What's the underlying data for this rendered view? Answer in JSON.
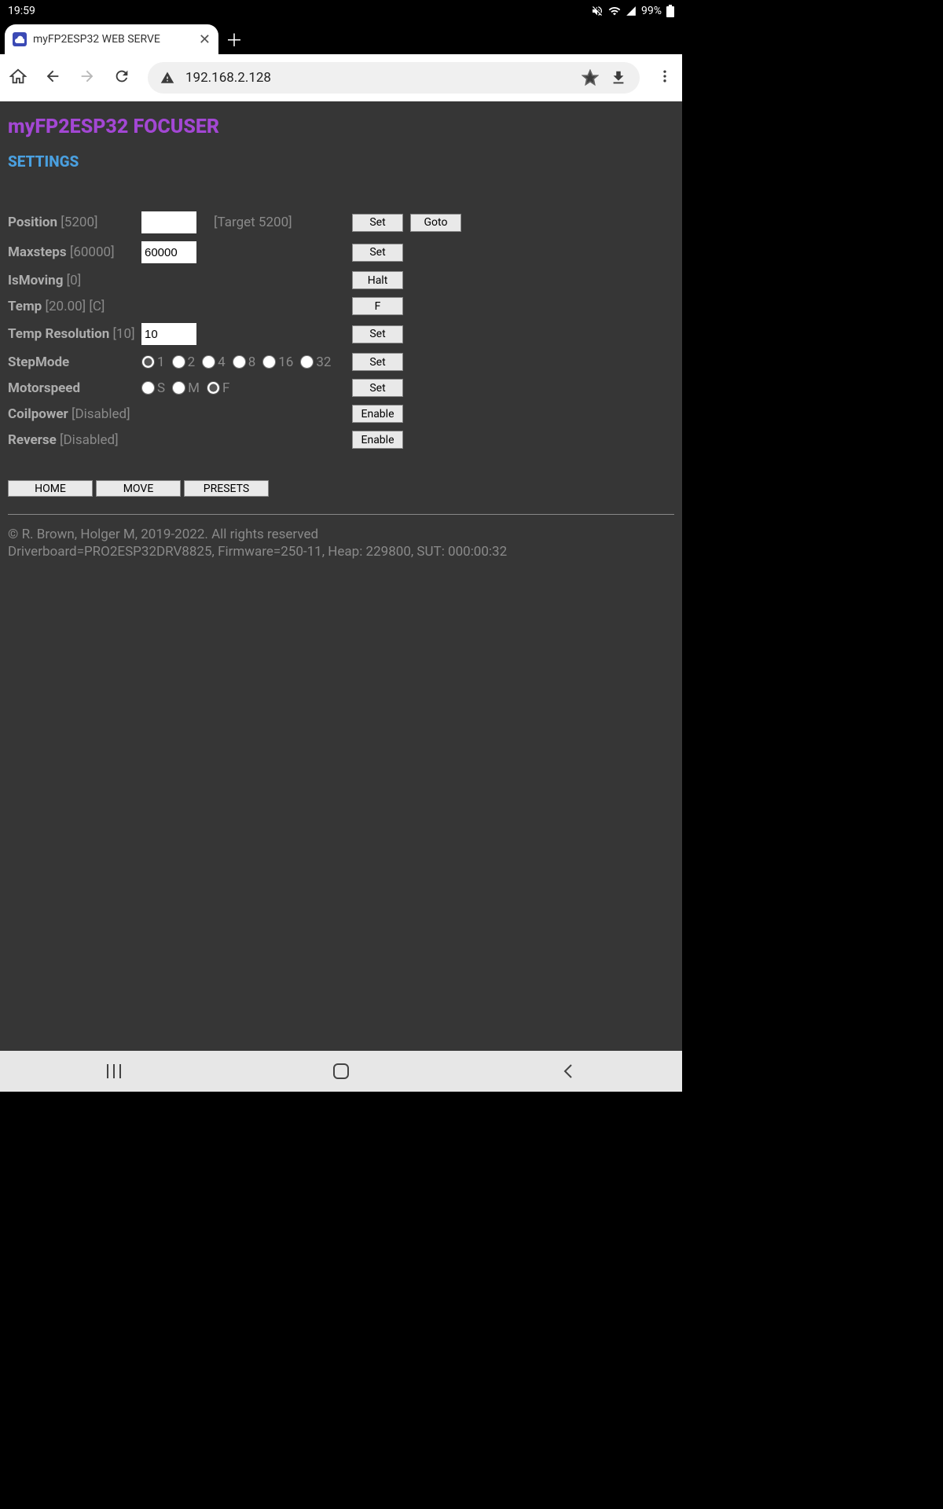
{
  "statusbar": {
    "time": "19:59",
    "battery": "99%"
  },
  "browser": {
    "tab_title": "myFP2ESP32 WEB SERVE",
    "url": "192.168.2.128"
  },
  "page": {
    "title": "myFP2ESP32 FOCUSER",
    "subtitle": "SETTINGS"
  },
  "fields": {
    "position_label": "Position",
    "position_val": "[5200]",
    "position_input": "",
    "target_label": "[Target 5200]",
    "set": "Set",
    "goto": "Goto",
    "maxsteps_label": "Maxsteps",
    "maxsteps_val": "[60000]",
    "maxsteps_input": "60000",
    "ismoving_label": "IsMoving",
    "ismoving_val": "[0]",
    "halt": "Halt",
    "temp_label": "Temp",
    "temp_val": "[20.00] [C]",
    "f": "F",
    "tempres_label": "Temp Resolution",
    "tempres_val": "[10]",
    "tempres_input": "10",
    "stepmode_label": "StepMode",
    "step_1": "1",
    "step_2": "2",
    "step_4": "4",
    "step_8": "8",
    "step_16": "16",
    "step_32": "32",
    "motorspeed_label": "Motorspeed",
    "ms_s": "S",
    "ms_m": "M",
    "ms_f": "F",
    "coilpower_label": "Coilpower",
    "coilpower_val": "[Disabled]",
    "enable": "Enable",
    "reverse_label": "Reverse",
    "reverse_val": "[Disabled]"
  },
  "links": {
    "home": "HOME",
    "move": "MOVE",
    "presets": "PRESETS"
  },
  "footer": {
    "line1": "© R. Brown, Holger M, 2019-2022. All rights reserved",
    "line2": "Driverboard=PRO2ESP32DRV8825, Firmware=250-11, Heap: 229800, SUT: 000:00:32"
  }
}
